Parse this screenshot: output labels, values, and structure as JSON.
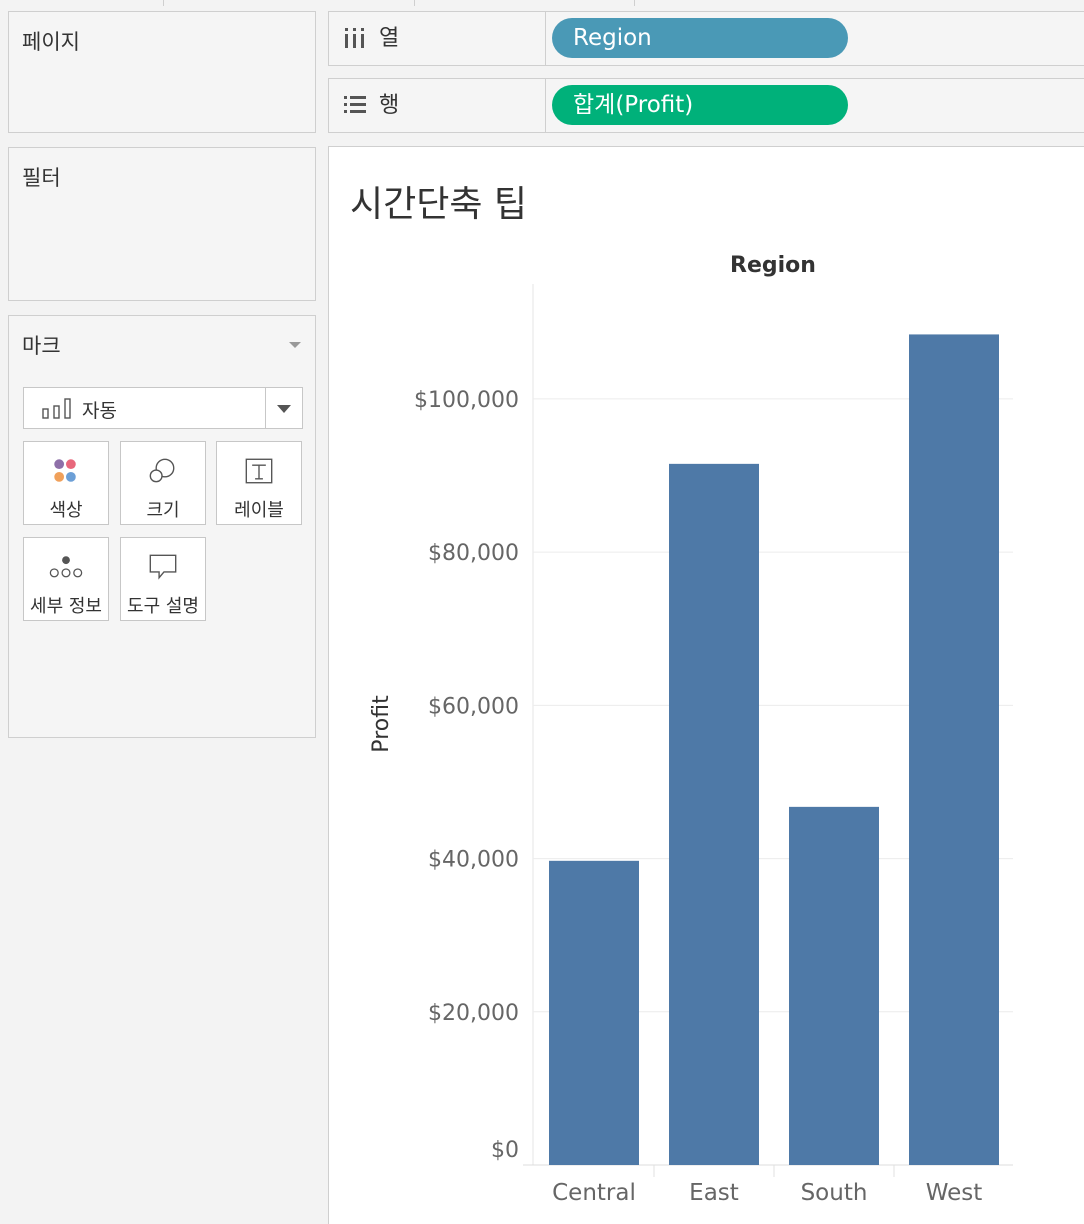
{
  "sidebar": {
    "pages_title": "페이지",
    "filters_title": "필터",
    "marks": {
      "title": "마크",
      "mark_type": "자동",
      "buttons": [
        {
          "label": "색상",
          "icon": "color-dots-icon"
        },
        {
          "label": "크기",
          "icon": "size-circles-icon"
        },
        {
          "label": "레이블",
          "icon": "label-t-icon"
        },
        {
          "label": "세부 정보",
          "icon": "detail-dots-icon"
        },
        {
          "label": "도구 설명",
          "icon": "tooltip-bubble-icon"
        }
      ]
    }
  },
  "shelves": {
    "columns": {
      "label": "열",
      "pill": "Region",
      "pill_color": "#4a99b6",
      "icon": "columns-icon"
    },
    "rows": {
      "label": "행",
      "pill": "합계(Profit)",
      "pill_color": "#00b17a",
      "icon": "rows-icon"
    }
  },
  "sheet": {
    "title": "시간단축 팁"
  },
  "chart_data": {
    "type": "bar",
    "header": "Region",
    "categories": [
      "Central",
      "East",
      "South",
      "West"
    ],
    "values": [
      39706,
      91523,
      46749,
      108418
    ],
    "ylabel": "Profit",
    "ylim": [
      0,
      115000
    ],
    "yticks": [
      0,
      20000,
      40000,
      60000,
      80000,
      100000
    ],
    "ytick_labels": [
      "$0",
      "$20,000",
      "$40,000",
      "$60,000",
      "$80,000",
      "$100,000"
    ],
    "bar_color": "#4e79a7",
    "grid": true
  }
}
